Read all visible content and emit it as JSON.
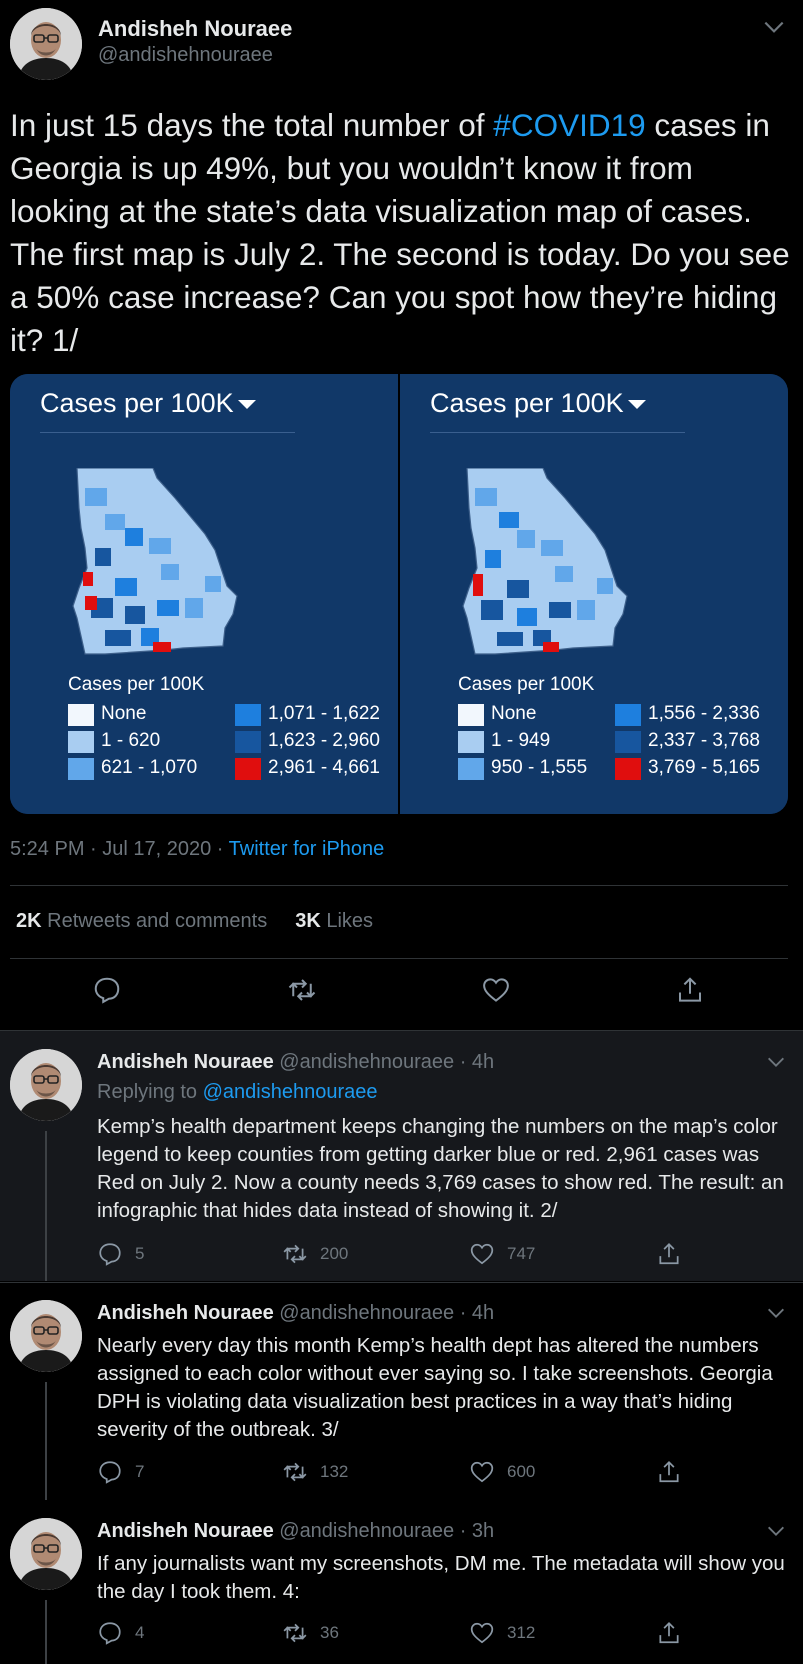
{
  "main_tweet": {
    "name": "Andisheh Nouraee",
    "handle": "@andishehnouraee",
    "text_before": "In just 15 days the total number of ",
    "hashtag": "#COVID19",
    "text_after": " cases in Georgia is up 49%, but you wouldn’t know it from looking at the state’s data visualization map of cases. The first map is July 2. The second is today. Do you see a 50% case increase? Can you spot how they’re hiding it? 1/",
    "time": "5:24 PM · Jul 17, 2020 · ",
    "source": "Twitter for iPhone",
    "retweets_count": "2K",
    "retweets_label": " Retweets and comments",
    "likes_count": "3K",
    "likes_label": " Likes"
  },
  "maps": [
    {
      "header": "Cases per 100K",
      "legend_title": "Cases per 100K",
      "legend": [
        {
          "label": "None",
          "color": "#f2f7fd"
        },
        {
          "label": "1 - 620",
          "color": "#a9cdf1"
        },
        {
          "label": "621 - 1,070",
          "color": "#61a7ea"
        },
        {
          "label": "1,071 - 1,622",
          "color": "#1e7fde"
        },
        {
          "label": "1,623 - 2,960",
          "color": "#17569f"
        },
        {
          "label": "2,961 - 4,661",
          "color": "#e00e0e"
        }
      ]
    },
    {
      "header": "Cases per 100K",
      "legend_title": "Cases per 100K",
      "legend": [
        {
          "label": "None",
          "color": "#f2f7fd"
        },
        {
          "label": "1 - 949",
          "color": "#a9cdf1"
        },
        {
          "label": "950 - 1,555",
          "color": "#61a7ea"
        },
        {
          "label": "1,556 - 2,336",
          "color": "#1e7fde"
        },
        {
          "label": "2,337 - 3,768",
          "color": "#17569f"
        },
        {
          "label": "3,769 - 5,165",
          "color": "#e00e0e"
        }
      ]
    }
  ],
  "replies": [
    {
      "name": "Andisheh Nouraee",
      "handle_time": " @andishehnouraee · 4h",
      "replying_prefix": "Replying to ",
      "replying_to": "@andishehnouraee",
      "text": "Kemp’s health department keeps changing the numbers on the map’s color legend to keep counties from getting darker blue or red. 2,961 cases was Red on July 2. Now a county needs 3,769 cases to show red. The result: an infographic that hides data instead of showing it. 2/",
      "replies": "5",
      "retweets": "200",
      "likes": "747"
    },
    {
      "name": "Andisheh Nouraee",
      "handle_time": " @andishehnouraee · 4h",
      "text": "Nearly every day this month Kemp’s health dept has altered the numbers assigned to each color without ever saying so. I take screenshots. Georgia DPH is violating data visualization best practices in a way that’s hiding severity of the outbreak. 3/",
      "replies": "7",
      "retweets": "132",
      "likes": "600"
    },
    {
      "name": "Andisheh Nouraee",
      "handle_time": " @andishehnouraee · 3h",
      "text": "If any journalists want my screenshots, DM me. The metadata will show you the day I took them. 4:",
      "replies": "4",
      "retweets": "36",
      "likes": "312"
    }
  ]
}
